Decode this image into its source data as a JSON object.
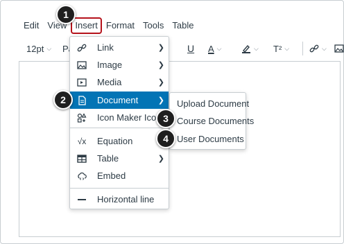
{
  "menubar": {
    "items": [
      {
        "label": "Edit"
      },
      {
        "label": "View"
      },
      {
        "label": "Insert"
      },
      {
        "label": "Format"
      },
      {
        "label": "Tools"
      },
      {
        "label": "Table"
      }
    ],
    "active": "Insert"
  },
  "toolbar": {
    "font_size": "12pt",
    "paragraph": "Pa",
    "underline": "U",
    "text_color": "A",
    "superscript": "T²"
  },
  "insert_menu": {
    "items": [
      {
        "label": "Link",
        "icon": "link-icon",
        "has_submenu": true
      },
      {
        "label": "Image",
        "icon": "image-icon",
        "has_submenu": true
      },
      {
        "label": "Media",
        "icon": "media-icon",
        "has_submenu": true
      },
      {
        "label": "Document",
        "icon": "document-icon",
        "has_submenu": true,
        "selected": true
      },
      {
        "label": "Icon Maker Icons",
        "icon": "shapes-icon",
        "has_submenu": false
      },
      {
        "label": "Equation",
        "icon": "equation-icon",
        "has_submenu": false
      },
      {
        "label": "Table",
        "icon": "table-icon",
        "has_submenu": true
      },
      {
        "label": "Embed",
        "icon": "embed-icon",
        "has_submenu": false
      },
      {
        "label": "Horizontal line",
        "icon": "horizontal-line-icon",
        "has_submenu": false
      }
    ]
  },
  "document_submenu": {
    "items": [
      {
        "label": "Upload Document"
      },
      {
        "label": "Course Documents"
      },
      {
        "label": "User Documents"
      }
    ]
  },
  "callouts": [
    "1",
    "2",
    "3",
    "4"
  ],
  "colors": {
    "selected_bg": "#0374b5",
    "highlight_border": "#b5121b",
    "callout_bg": "#1f1f1f",
    "text": "#2d3b45"
  }
}
